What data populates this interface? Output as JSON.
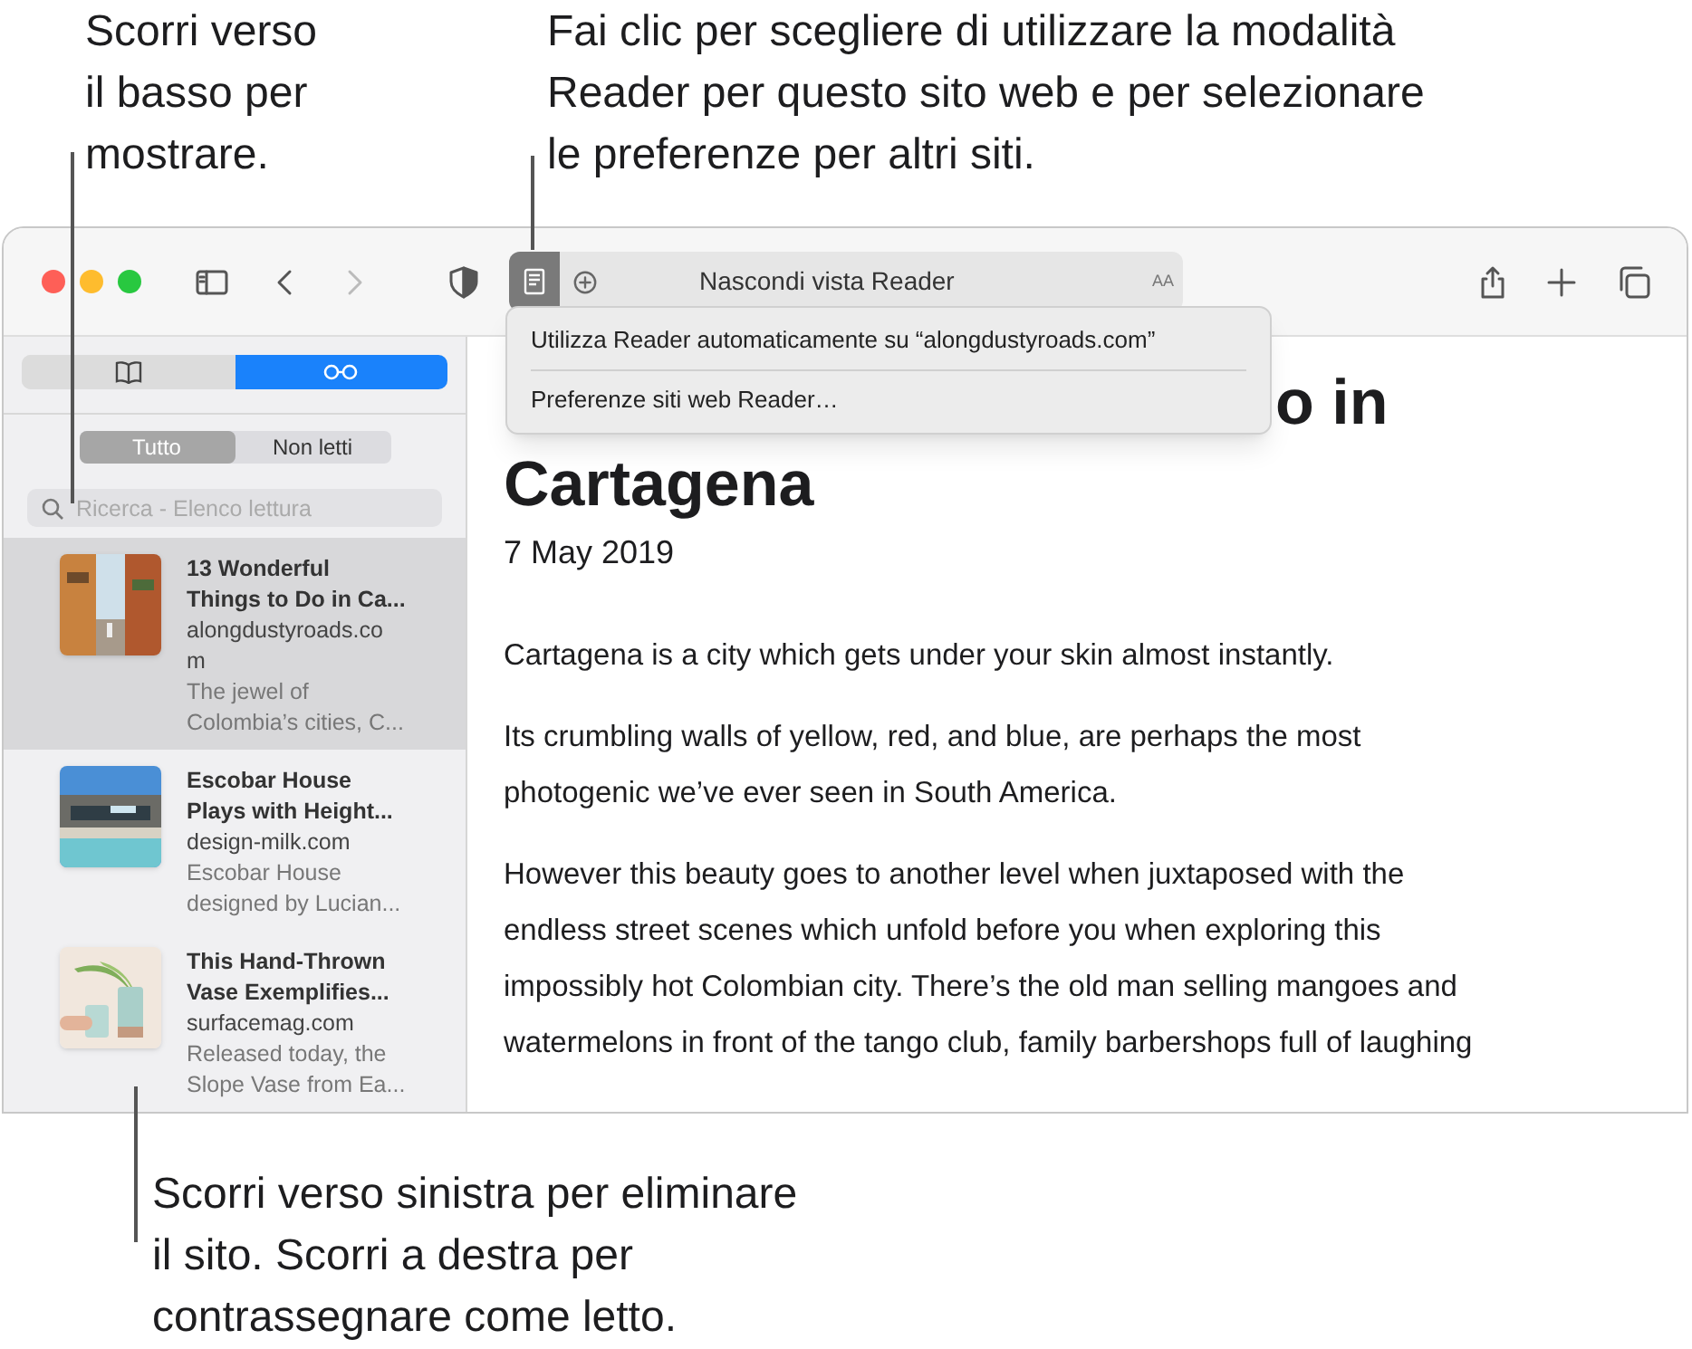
{
  "callouts_top": [
    {
      "text": "Scorri verso\nil basso per\nmostrare."
    },
    {
      "text": "Fai clic per scegliere di utilizzare la modalità\nReader per questo sito web e per selezionare\nle preferenze per altri siti."
    }
  ],
  "toolbar": {
    "address_text": "Nascondi vista Reader",
    "text_size": "AA",
    "reader_on": true
  },
  "popup_menu": {
    "items": [
      "Utilizza Reader automaticamente su “alongdustyroads.com”",
      "Preferenze siti web Reader…"
    ]
  },
  "sidebar": {
    "tabs": [
      {
        "kind": "bookmarks",
        "selected": false
      },
      {
        "kind": "reading_list",
        "selected": true
      }
    ],
    "filters": [
      {
        "label": "Tutto",
        "selected": true
      },
      {
        "label": "Non letti",
        "selected": false
      }
    ],
    "search": {
      "placeholder": "Ricerca - Elenco lettura"
    },
    "items": [
      {
        "title": "13 Wonderful\nThings to Do in Ca...",
        "site": "alongdustyroads.co\nm",
        "excerpt": "The jewel of\nColombia’s cities, C...",
        "selected": true,
        "kind": "picture"
      },
      {
        "title": "Escobar House\nPlays with Height...",
        "site": "design-milk.com",
        "excerpt": "Escobar House\ndesigned by Lucian...",
        "selected": false,
        "kind": "picture"
      },
      {
        "title": "This Hand-Thrown\nVase Exemplifies...",
        "site": "surfacemag.com",
        "excerpt": "Released today, the\nSlope Vase from Ea...",
        "selected": false,
        "kind": "picture"
      }
    ]
  },
  "article": {
    "heading_lines": [
      "o in",
      "Cartagena"
    ],
    "date": "7 May 2019",
    "paragraphs": [
      "Cartagena is a city which gets under your skin almost instantly.",
      "Its crumbling walls of yellow, red, and blue, are perhaps the most\nphotogenic we’ve ever seen in South America.",
      "However this beauty goes to another level when juxtaposed with the\nendless street scenes which unfold before you when exploring this\nimpossibly hot Colombian city. There’s the old man selling mangoes and\nwatermelons in front of the tango club, family barbershops full of laughing"
    ]
  },
  "callout_bottom": {
    "text": "Scorri verso sinistra per eliminare\nil sito. Scorri a destra per\ncontrassegnare come letto."
  }
}
